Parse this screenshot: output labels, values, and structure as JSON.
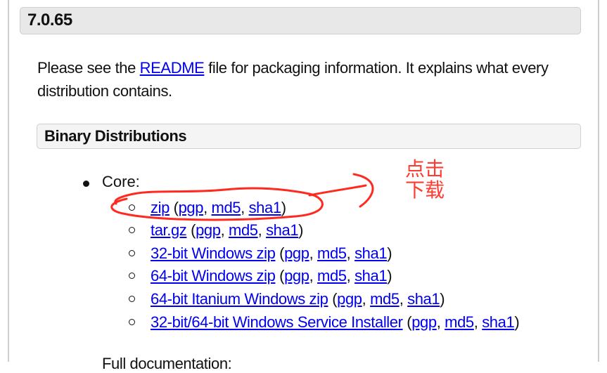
{
  "version_heading": "7.0.65",
  "intro": {
    "before": "Please see the ",
    "link": "README",
    "after": " file for packaging information. It explains what every distribution contains."
  },
  "section_heading": "Binary Distributions",
  "core_label": "Core:",
  "core_items": [
    {
      "name": "zip",
      "pgp": "pgp",
      "md5": "md5",
      "sha1": "sha1"
    },
    {
      "name": "tar.gz",
      "pgp": "pgp",
      "md5": "md5",
      "sha1": "sha1"
    },
    {
      "name": "32-bit Windows zip",
      "pgp": "pgp",
      "md5": "md5",
      "sha1": "sha1"
    },
    {
      "name": "64-bit Windows zip",
      "pgp": "pgp",
      "md5": "md5",
      "sha1": "sha1"
    },
    {
      "name": "64-bit Itanium Windows zip",
      "pgp": "pgp",
      "md5": "md5",
      "sha1": "sha1"
    },
    {
      "name": "32-bit/64-bit Windows Service Installer",
      "pgp": "pgp",
      "md5": "md5",
      "sha1": "sha1"
    }
  ],
  "next_item_cut": "Full documentation:",
  "annotation": {
    "text": "点击下载",
    "color": "#ff3b30"
  },
  "link_color": "#0000ee"
}
